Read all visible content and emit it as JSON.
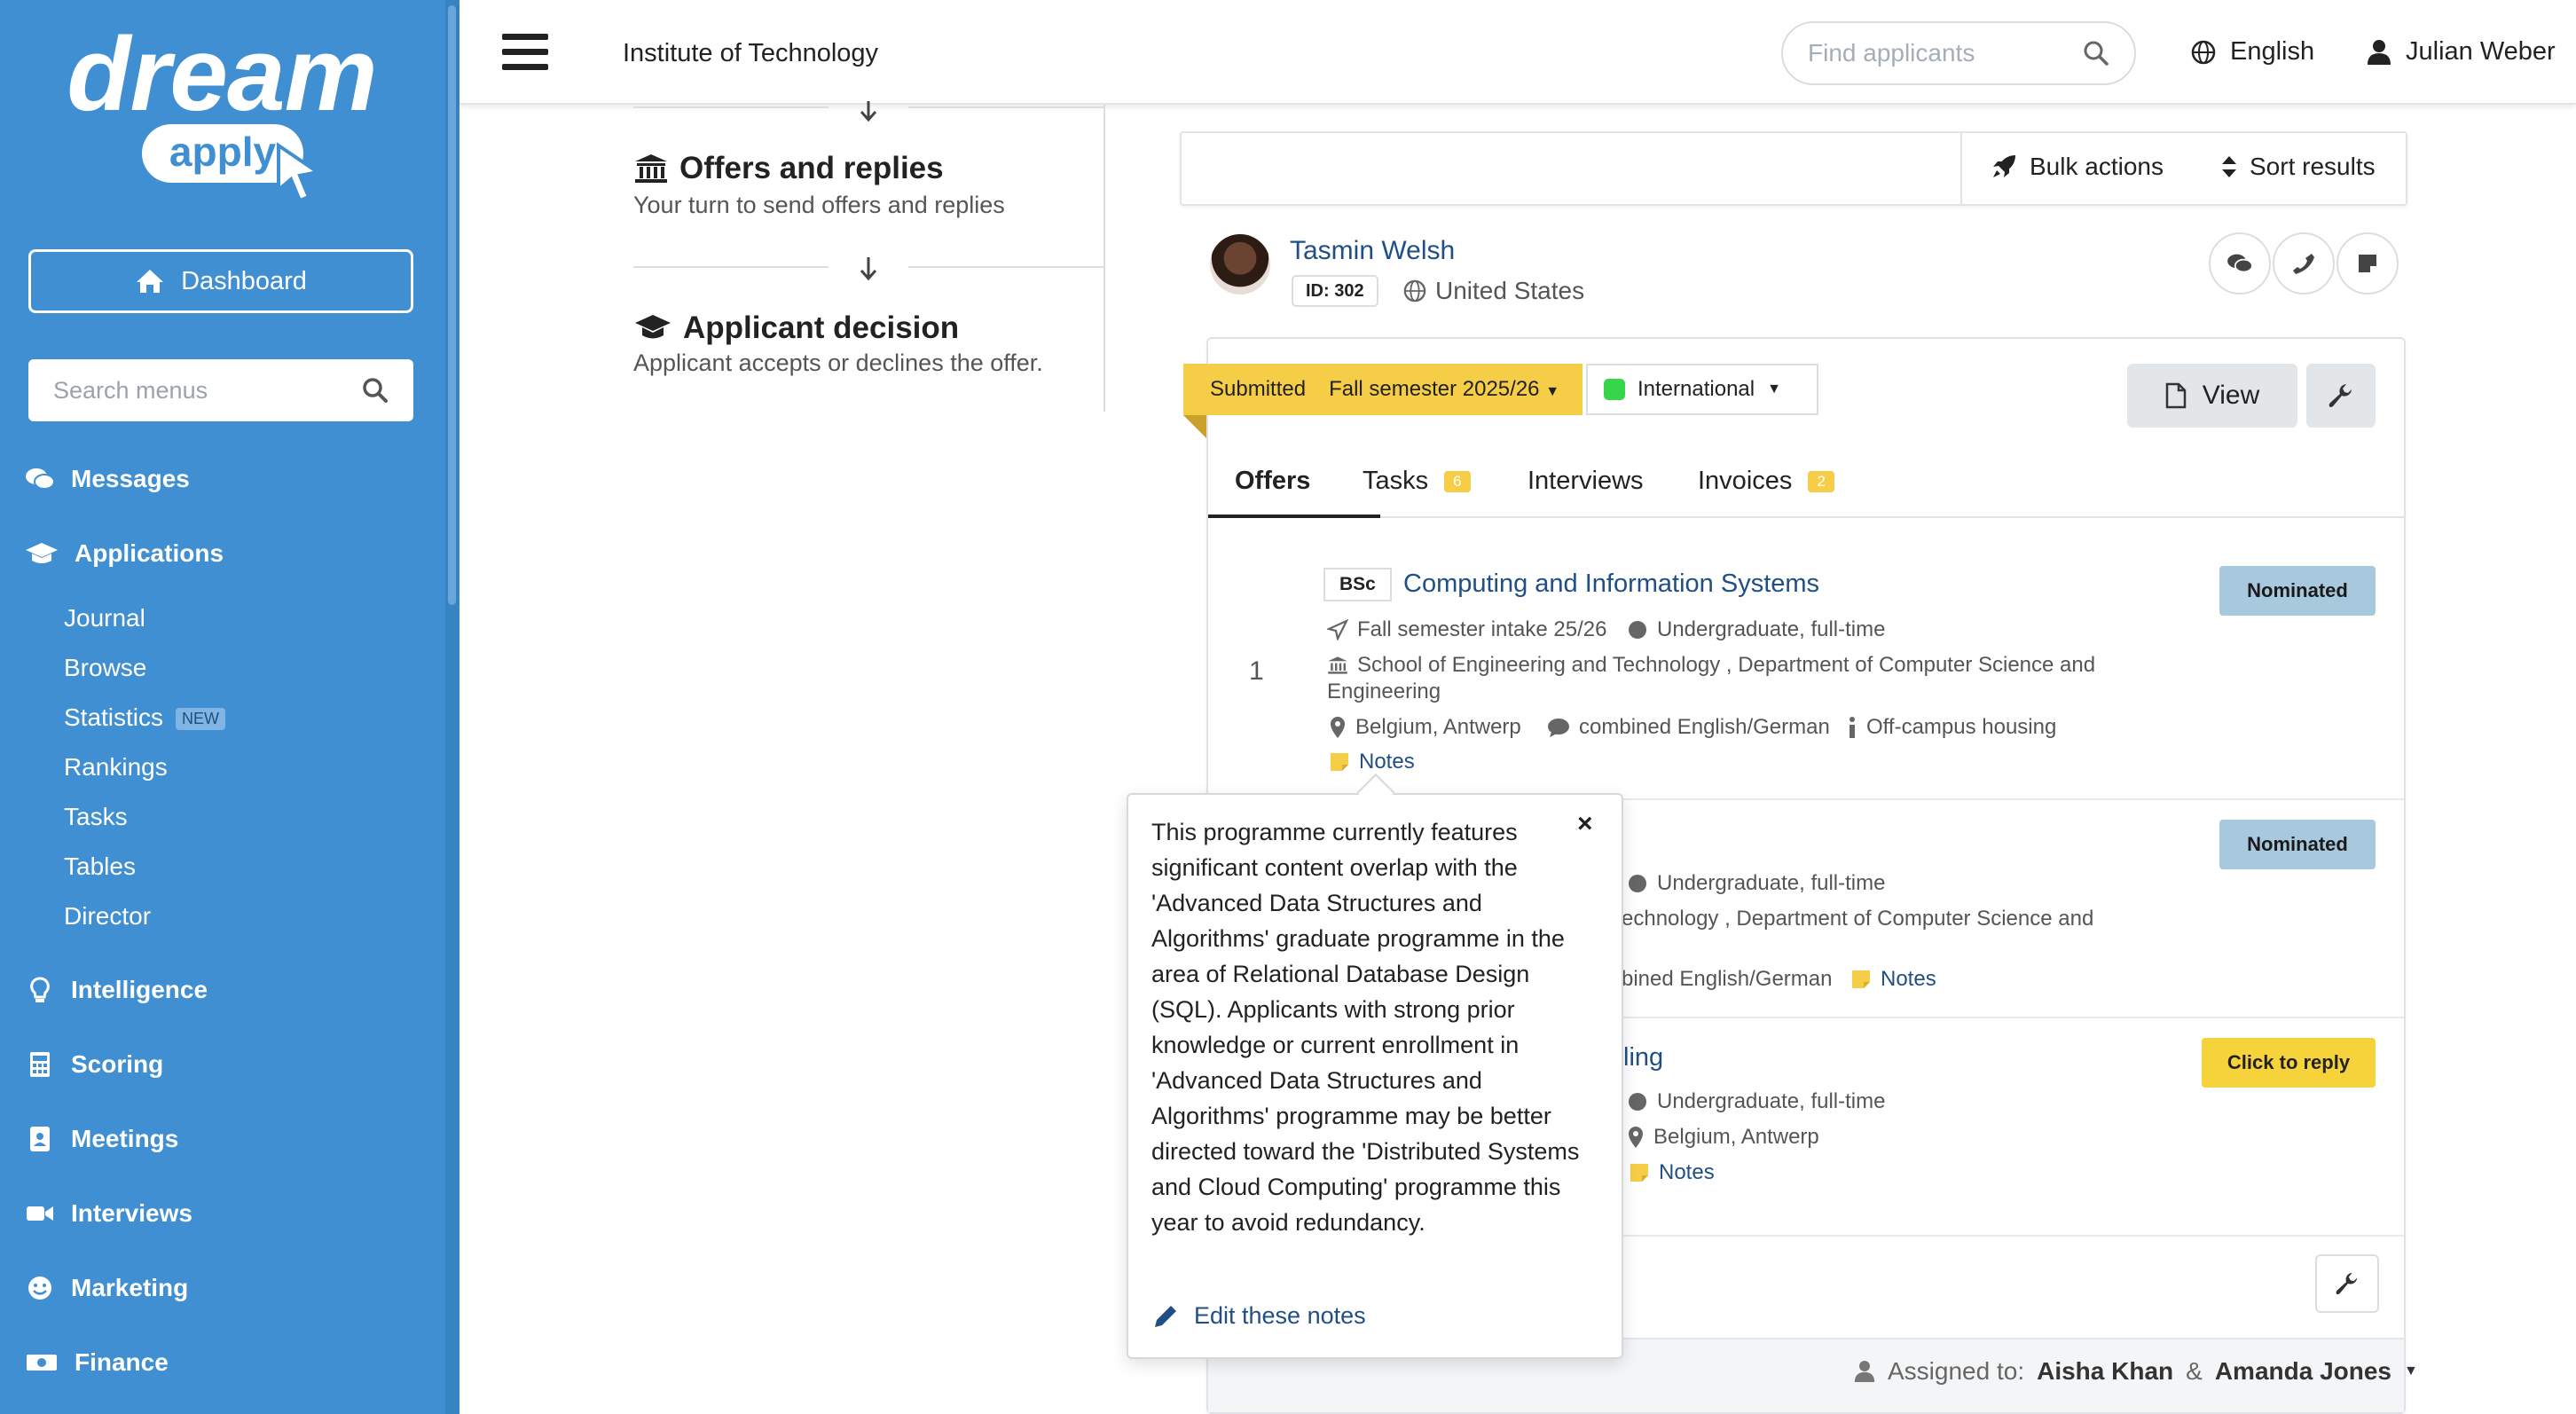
{
  "sidebar": {
    "logo_main": "dream",
    "logo_sub": "apply",
    "dashboard": "Dashboard",
    "search_placeholder": "Search menus",
    "messages": "Messages",
    "applications": "Applications",
    "sub_items": [
      "Journal",
      "Browse",
      "Statistics",
      "Rankings",
      "Tasks",
      "Tables",
      "Director"
    ],
    "new_badge": "NEW",
    "intelligence": "Intelligence",
    "scoring": "Scoring",
    "meetings": "Meetings",
    "interviews": "Interviews",
    "marketing": "Marketing",
    "finance": "Finance"
  },
  "header": {
    "org": "Institute of Technology",
    "search_placeholder": "Find applicants",
    "language": "English",
    "user": "Julian Weber"
  },
  "workflow": {
    "offers_title": "Offers and replies",
    "offers_sub": "Your turn to send offers and replies",
    "decision_title": "Applicant decision",
    "decision_sub": "Applicant accepts or declines the offer."
  },
  "toolbar": {
    "bulk": "Bulk actions",
    "sort": "Sort results"
  },
  "applicant": {
    "name": "Tasmin Welsh",
    "id": "ID: 302",
    "country": "United States"
  },
  "application": {
    "status": "Submitted",
    "semester": "Fall semester 2025/26",
    "group": "International",
    "group_color": "#37d64a",
    "view": "View"
  },
  "tabs": {
    "offers": "Offers",
    "tasks": "Tasks",
    "tasks_count": "6",
    "interviews": "Interviews",
    "invoices": "Invoices",
    "invoices_count": "2"
  },
  "offer1": {
    "num": "1",
    "degree": "BSc",
    "title": "Computing and Information Systems",
    "intake": "Fall semester intake 25/26",
    "level": "Undergraduate, full-time",
    "school": "School of Engineering and Technology , Department of Computer Science and",
    "school_cont": "Engineering",
    "location": "Belgium, Antwerp",
    "language": "combined English/German",
    "housing": "Off-campus housing",
    "notes": "Notes",
    "badge": "Nominated"
  },
  "offer2": {
    "level": "Undergraduate, full-time",
    "school_partial": "echnology , Department of Computer Science and",
    "language_partial": "bined English/German",
    "notes": "Notes",
    "badge": "Nominated"
  },
  "offer3": {
    "title_partial": "ling",
    "level": "Undergraduate, full-time",
    "location": "Belgium, Antwerp",
    "notes": "Notes",
    "badge": "Click to reply"
  },
  "assigned": {
    "label": "Assigned to:",
    "person1": "Aisha Khan",
    "amp": "&",
    "person2": "Amanda Jones"
  },
  "popover": {
    "text": "This programme currently features significant content overlap with the 'Advanced Data Structures and Algorithms' graduate programme in the area of Relational Database Design (SQL). Applicants with strong prior knowledge or current enrollment in 'Advanced Data Structures and Algorithms' programme may be better directed toward the 'Distributed Systems and Cloud Computing' programme this year to avoid redundancy.",
    "close": "×",
    "edit": "Edit these notes"
  }
}
